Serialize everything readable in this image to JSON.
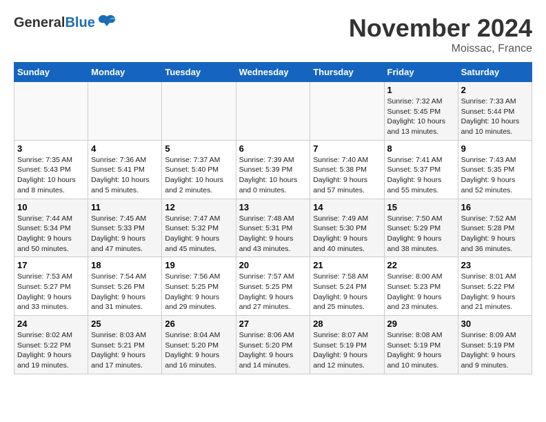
{
  "header": {
    "logo_general": "General",
    "logo_blue": "Blue",
    "month": "November 2024",
    "location": "Moissac, France"
  },
  "weekdays": [
    "Sunday",
    "Monday",
    "Tuesday",
    "Wednesday",
    "Thursday",
    "Friday",
    "Saturday"
  ],
  "weeks": [
    [
      {
        "day": "",
        "info": ""
      },
      {
        "day": "",
        "info": ""
      },
      {
        "day": "",
        "info": ""
      },
      {
        "day": "",
        "info": ""
      },
      {
        "day": "",
        "info": ""
      },
      {
        "day": "1",
        "info": "Sunrise: 7:32 AM\nSunset: 5:45 PM\nDaylight: 10 hours and 13 minutes."
      },
      {
        "day": "2",
        "info": "Sunrise: 7:33 AM\nSunset: 5:44 PM\nDaylight: 10 hours and 10 minutes."
      }
    ],
    [
      {
        "day": "3",
        "info": "Sunrise: 7:35 AM\nSunset: 5:43 PM\nDaylight: 10 hours and 8 minutes."
      },
      {
        "day": "4",
        "info": "Sunrise: 7:36 AM\nSunset: 5:41 PM\nDaylight: 10 hours and 5 minutes."
      },
      {
        "day": "5",
        "info": "Sunrise: 7:37 AM\nSunset: 5:40 PM\nDaylight: 10 hours and 2 minutes."
      },
      {
        "day": "6",
        "info": "Sunrise: 7:39 AM\nSunset: 5:39 PM\nDaylight: 10 hours and 0 minutes."
      },
      {
        "day": "7",
        "info": "Sunrise: 7:40 AM\nSunset: 5:38 PM\nDaylight: 9 hours and 57 minutes."
      },
      {
        "day": "8",
        "info": "Sunrise: 7:41 AM\nSunset: 5:37 PM\nDaylight: 9 hours and 55 minutes."
      },
      {
        "day": "9",
        "info": "Sunrise: 7:43 AM\nSunset: 5:35 PM\nDaylight: 9 hours and 52 minutes."
      }
    ],
    [
      {
        "day": "10",
        "info": "Sunrise: 7:44 AM\nSunset: 5:34 PM\nDaylight: 9 hours and 50 minutes."
      },
      {
        "day": "11",
        "info": "Sunrise: 7:45 AM\nSunset: 5:33 PM\nDaylight: 9 hours and 47 minutes."
      },
      {
        "day": "12",
        "info": "Sunrise: 7:47 AM\nSunset: 5:32 PM\nDaylight: 9 hours and 45 minutes."
      },
      {
        "day": "13",
        "info": "Sunrise: 7:48 AM\nSunset: 5:31 PM\nDaylight: 9 hours and 43 minutes."
      },
      {
        "day": "14",
        "info": "Sunrise: 7:49 AM\nSunset: 5:30 PM\nDaylight: 9 hours and 40 minutes."
      },
      {
        "day": "15",
        "info": "Sunrise: 7:50 AM\nSunset: 5:29 PM\nDaylight: 9 hours and 38 minutes."
      },
      {
        "day": "16",
        "info": "Sunrise: 7:52 AM\nSunset: 5:28 PM\nDaylight: 9 hours and 36 minutes."
      }
    ],
    [
      {
        "day": "17",
        "info": "Sunrise: 7:53 AM\nSunset: 5:27 PM\nDaylight: 9 hours and 33 minutes."
      },
      {
        "day": "18",
        "info": "Sunrise: 7:54 AM\nSunset: 5:26 PM\nDaylight: 9 hours and 31 minutes."
      },
      {
        "day": "19",
        "info": "Sunrise: 7:56 AM\nSunset: 5:25 PM\nDaylight: 9 hours and 29 minutes."
      },
      {
        "day": "20",
        "info": "Sunrise: 7:57 AM\nSunset: 5:25 PM\nDaylight: 9 hours and 27 minutes."
      },
      {
        "day": "21",
        "info": "Sunrise: 7:58 AM\nSunset: 5:24 PM\nDaylight: 9 hours and 25 minutes."
      },
      {
        "day": "22",
        "info": "Sunrise: 8:00 AM\nSunset: 5:23 PM\nDaylight: 9 hours and 23 minutes."
      },
      {
        "day": "23",
        "info": "Sunrise: 8:01 AM\nSunset: 5:22 PM\nDaylight: 9 hours and 21 minutes."
      }
    ],
    [
      {
        "day": "24",
        "info": "Sunrise: 8:02 AM\nSunset: 5:22 PM\nDaylight: 9 hours and 19 minutes."
      },
      {
        "day": "25",
        "info": "Sunrise: 8:03 AM\nSunset: 5:21 PM\nDaylight: 9 hours and 17 minutes."
      },
      {
        "day": "26",
        "info": "Sunrise: 8:04 AM\nSunset: 5:20 PM\nDaylight: 9 hours and 16 minutes."
      },
      {
        "day": "27",
        "info": "Sunrise: 8:06 AM\nSunset: 5:20 PM\nDaylight: 9 hours and 14 minutes."
      },
      {
        "day": "28",
        "info": "Sunrise: 8:07 AM\nSunset: 5:19 PM\nDaylight: 9 hours and 12 minutes."
      },
      {
        "day": "29",
        "info": "Sunrise: 8:08 AM\nSunset: 5:19 PM\nDaylight: 9 hours and 10 minutes."
      },
      {
        "day": "30",
        "info": "Sunrise: 8:09 AM\nSunset: 5:19 PM\nDaylight: 9 hours and 9 minutes."
      }
    ]
  ]
}
